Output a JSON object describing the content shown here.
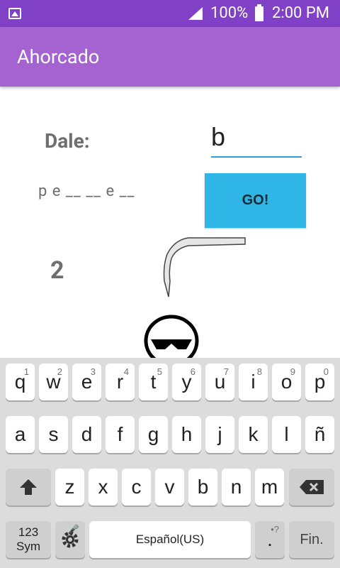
{
  "status_bar": {
    "battery": "100%",
    "time": "2:00 PM",
    "icons": [
      "image-icon",
      "signal-icon",
      "battery-icon"
    ]
  },
  "app_bar": {
    "title": "Ahorcado"
  },
  "game": {
    "prompt_label": "Dale:",
    "input_value": "b",
    "word_display": "p e __ __ e __",
    "go_label": "GO!",
    "count": "2"
  },
  "keyboard": {
    "row1": [
      {
        "key": "q",
        "hint": "1"
      },
      {
        "key": "w",
        "hint": "2"
      },
      {
        "key": "e",
        "hint": "3"
      },
      {
        "key": "r",
        "hint": "4"
      },
      {
        "key": "t",
        "hint": "5"
      },
      {
        "key": "y",
        "hint": "6"
      },
      {
        "key": "u",
        "hint": "7"
      },
      {
        "key": "i",
        "hint": "8"
      },
      {
        "key": "o",
        "hint": "9"
      },
      {
        "key": "p",
        "hint": "0"
      }
    ],
    "row2": [
      "a",
      "s",
      "d",
      "f",
      "g",
      "h",
      "j",
      "k",
      "l",
      "ñ"
    ],
    "row3": [
      "z",
      "x",
      "c",
      "v",
      "b",
      "n",
      "m"
    ],
    "sym_line1": "123",
    "sym_line2": "Sym",
    "space_label": "Español(US)",
    "period": ".",
    "period_hint": "•?",
    "fin_label": "Fin."
  },
  "colors": {
    "status_bar": "#8041c6",
    "app_bar": "#a463d0",
    "go_button": "#2fb5e6",
    "input_underline": "#2d9fd6",
    "keyboard_bg": "#dcdcdc"
  }
}
